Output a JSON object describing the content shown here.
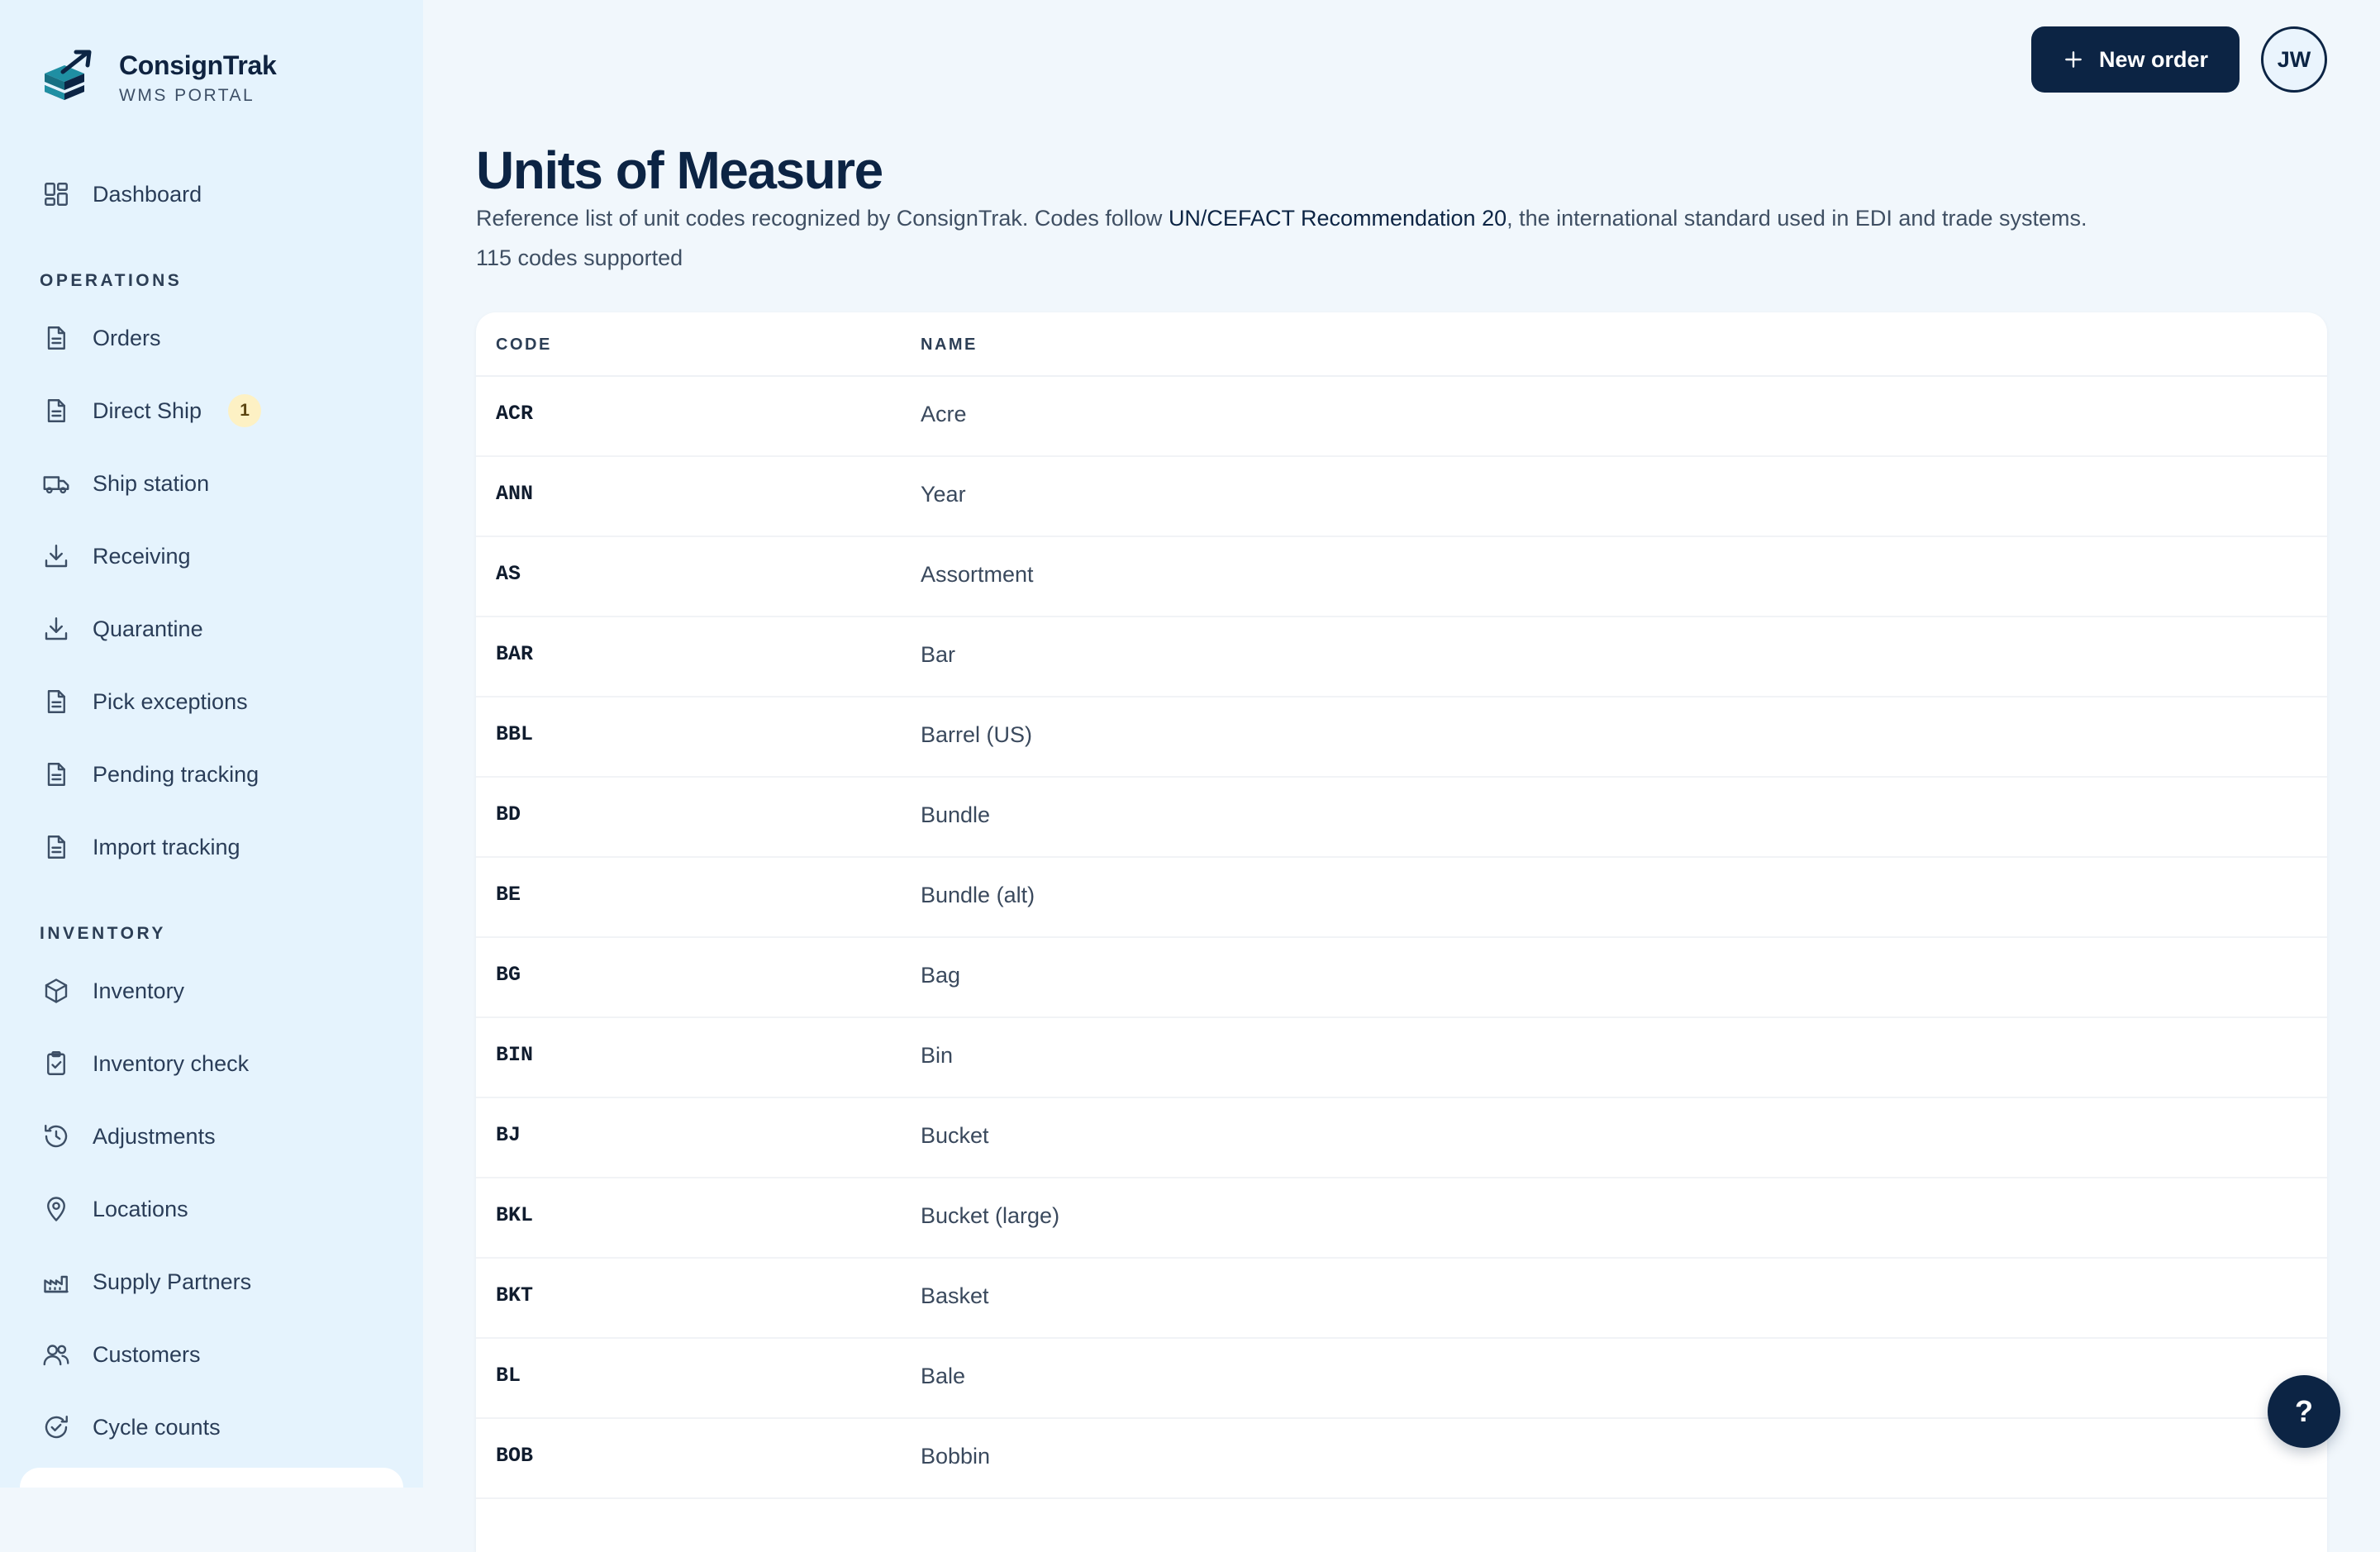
{
  "brand": {
    "name": "ConsignTrak",
    "subtitle": "WMS PORTAL",
    "logo_icon": "stacked-boxes-arrow-logo"
  },
  "sidebar": {
    "sections": {
      "operations": "OPERATIONS",
      "inventory": "INVENTORY"
    },
    "items": [
      {
        "label": "Dashboard",
        "icon": "dashboard-grid-icon"
      },
      {
        "label": "Orders",
        "icon": "document-icon"
      },
      {
        "label": "Direct Ship",
        "icon": "document-icon",
        "badge": "1"
      },
      {
        "label": "Ship station",
        "icon": "truck-icon"
      },
      {
        "label": "Receiving",
        "icon": "download-tray-icon"
      },
      {
        "label": "Quarantine",
        "icon": "download-tray-icon"
      },
      {
        "label": "Pick exceptions",
        "icon": "document-icon"
      },
      {
        "label": "Pending tracking",
        "icon": "document-icon"
      },
      {
        "label": "Import tracking",
        "icon": "document-icon"
      },
      {
        "label": "Inventory",
        "icon": "box-icon"
      },
      {
        "label": "Inventory check",
        "icon": "clipboard-check-icon"
      },
      {
        "label": "Adjustments",
        "icon": "history-icon"
      },
      {
        "label": "Locations",
        "icon": "map-pin-icon"
      },
      {
        "label": "Supply Partners",
        "icon": "factory-icon"
      },
      {
        "label": "Customers",
        "icon": "users-icon"
      },
      {
        "label": "Cycle counts",
        "icon": "refresh-check-icon"
      }
    ]
  },
  "topbar": {
    "new_order_label": "New order",
    "avatar_initials": "JW"
  },
  "page": {
    "title": "Units of Measure",
    "description_prefix": "Reference list of unit codes recognized by ConsignTrak. Codes follow ",
    "description_link": "UN/CEFACT Recommendation 20",
    "description_suffix": ", the international standard used in EDI and trade systems.",
    "count_text": "115 codes supported"
  },
  "table": {
    "headers": {
      "code": "CODE",
      "name": "NAME"
    },
    "rows": [
      {
        "code": "ACR",
        "name": "Acre"
      },
      {
        "code": "ANN",
        "name": "Year"
      },
      {
        "code": "AS",
        "name": "Assortment"
      },
      {
        "code": "BAR",
        "name": "Bar"
      },
      {
        "code": "BBL",
        "name": "Barrel (US)"
      },
      {
        "code": "BD",
        "name": "Bundle"
      },
      {
        "code": "BE",
        "name": "Bundle (alt)"
      },
      {
        "code": "BG",
        "name": "Bag"
      },
      {
        "code": "BIN",
        "name": "Bin"
      },
      {
        "code": "BJ",
        "name": "Bucket"
      },
      {
        "code": "BKL",
        "name": "Bucket (large)"
      },
      {
        "code": "BKT",
        "name": "Basket"
      },
      {
        "code": "BL",
        "name": "Bale"
      },
      {
        "code": "BOB",
        "name": "Bobbin"
      }
    ]
  },
  "help": {
    "label": "?"
  },
  "colors": {
    "primary": "#0c2444",
    "sidebar_bg": "#e5f3fd",
    "page_bg": "#f1f7fc",
    "logo_accent": "#1f8fa3",
    "badge_bg": "#fdf1c4"
  }
}
